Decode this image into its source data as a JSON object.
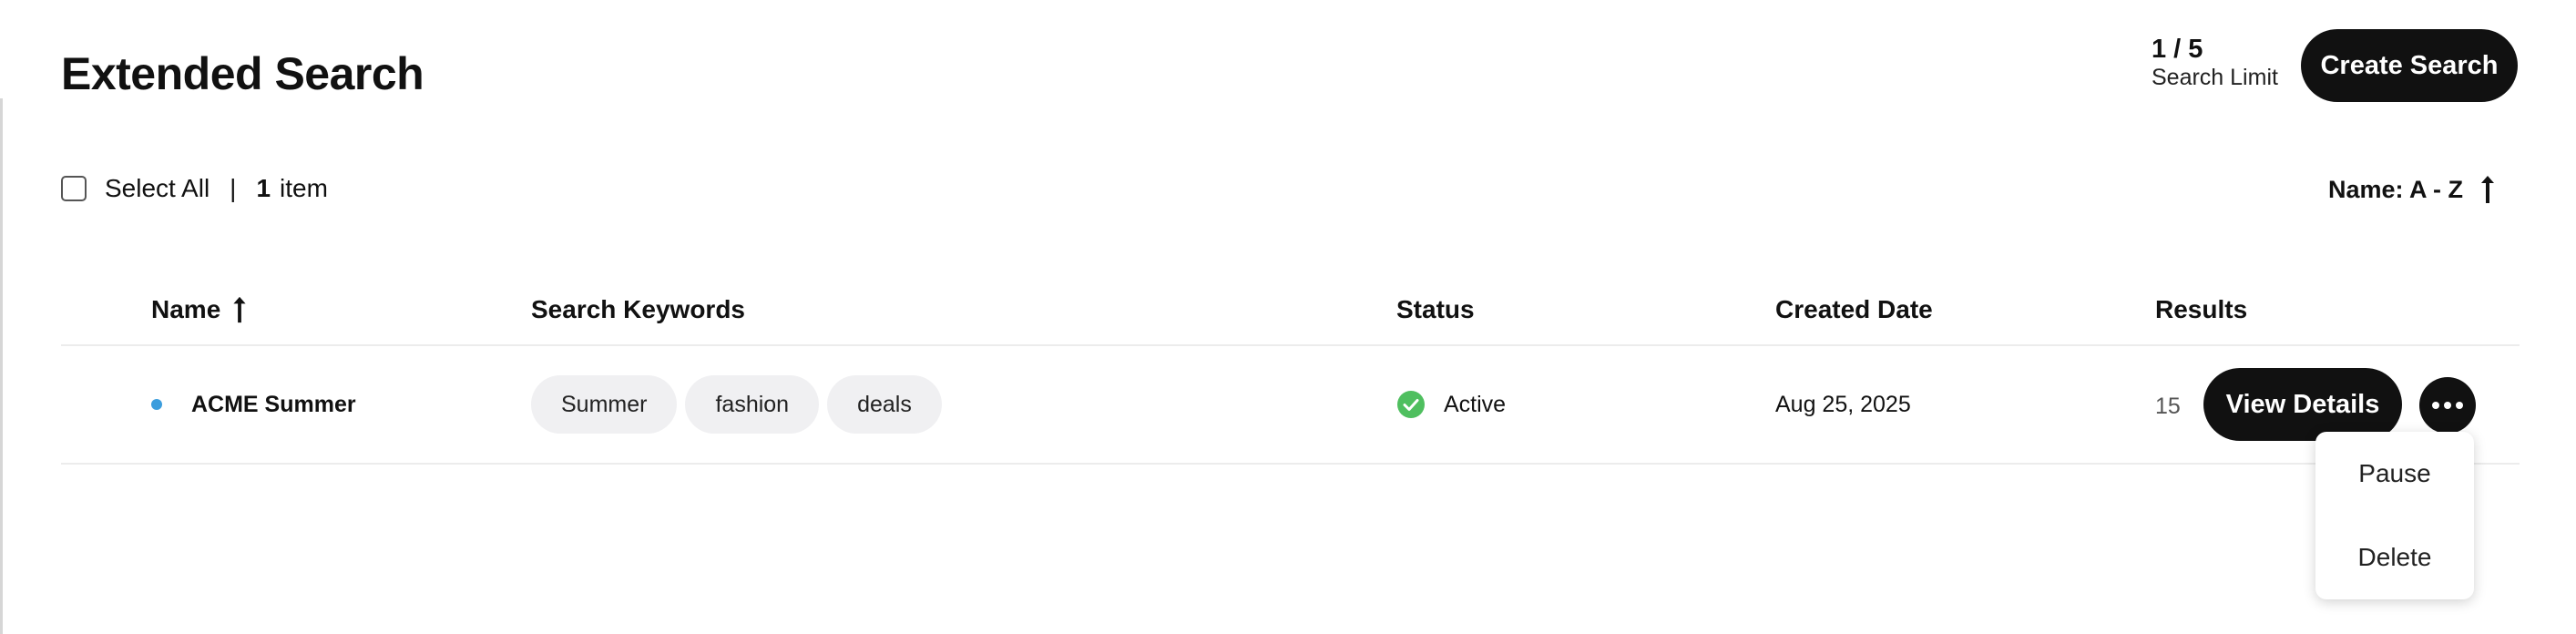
{
  "header": {
    "title": "Extended Search",
    "limit_count": "1 / 5",
    "limit_label": "Search Limit",
    "create_label": "Create Search"
  },
  "toolbar": {
    "select_all_label": "Select All",
    "separator": "|",
    "item_count": "1",
    "item_label": "item",
    "sort_label": "Name: A - Z",
    "sort_direction_icon": "arrow-up-icon"
  },
  "table": {
    "columns": [
      "Name",
      "Search Keywords",
      "Status",
      "Created Date",
      "Results"
    ],
    "sorted_column_icon": "arrow-up-icon",
    "rows": [
      {
        "name": "ACME Summer",
        "keywords": [
          "Summer",
          "fashion",
          "deals"
        ],
        "status": "Active",
        "created": "Aug 25, 2025",
        "results": "15",
        "view_label": "View Details"
      }
    ]
  },
  "row_menu": {
    "items": [
      "Pause",
      "Delete"
    ]
  },
  "colors": {
    "primary": "#111111",
    "status_active": "#4fbf5f",
    "row_dot": "#3b9ddd",
    "chip_bg": "#f0f0f2"
  }
}
